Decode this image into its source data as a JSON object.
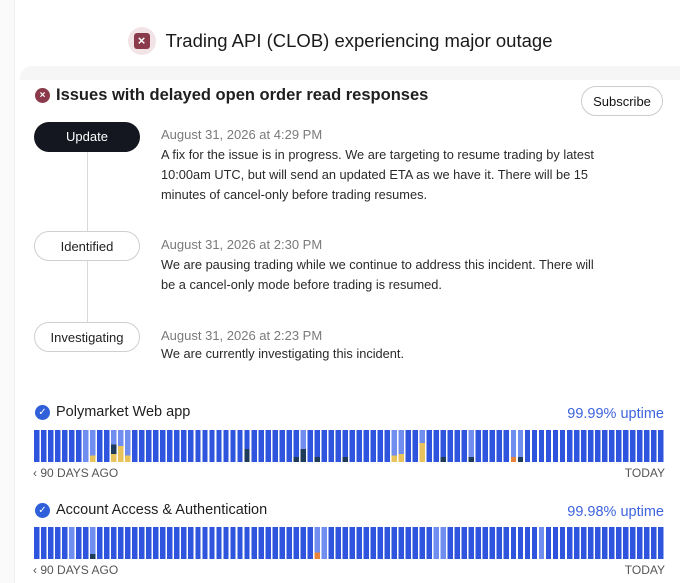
{
  "banner": {
    "icon": "x-square-icon",
    "title": "Trading API (CLOB) experiencing major outage"
  },
  "incident": {
    "icon": "x-circle-icon",
    "title": "Issues with delayed open order read responses",
    "subscribe_label": "Subscribe",
    "updates": [
      {
        "status": "Update",
        "date": "August 31, 2026 at 4:29 PM",
        "body": "A fix for the issue is in progress. We are targeting to resume trading by latest 10:00am UTC, but will send an updated ETA as we have it. There will be 15 minutes of cancel-only before trading resumes."
      },
      {
        "status": "Identified",
        "date": "August 31, 2026 at 2:30 PM",
        "body": "We are pausing trading while we continue to address this incident. There will be a cancel-only mode before trading is resumed."
      },
      {
        "status": "Investigating",
        "date": "August 31, 2026 at 2:23 PM",
        "body": "We are currently investigating this incident."
      }
    ]
  },
  "colors": {
    "accent": "#3d63dd",
    "bar_ok": "#2f55de",
    "bar_ok_light": "#6f8ef0",
    "bar_dark": "#1f3b5a",
    "bar_yellow": "#e8c25a",
    "bar_orange": "#e8843a",
    "incident": "#8a3a4a"
  },
  "components": [
    {
      "icon": "check-circle-icon",
      "name": "Polymarket Web app",
      "uptime": "99.99% uptime",
      "axis_left": "90 DAYS AGO",
      "axis_right": "TODAY",
      "days": [
        {
          "i": 7,
          "s": "light"
        },
        {
          "i": 8,
          "s": "light",
          "inc": [
            {
              "c": "yellow",
              "h": 0.2
            }
          ]
        },
        {
          "i": 11,
          "s": "light",
          "inc": [
            {
              "c": "yellow",
              "h": 0.25
            },
            {
              "c": "dark",
              "h": 0.3
            }
          ]
        },
        {
          "i": 12,
          "s": "light",
          "inc": [
            {
              "c": "yellow",
              "h": 0.5
            }
          ]
        },
        {
          "i": 13,
          "s": "light",
          "inc": [
            {
              "c": "yellow",
              "h": 0.2
            }
          ]
        },
        {
          "i": 30,
          "s": "ok",
          "inc": [
            {
              "c": "dark",
              "h": 0.4
            }
          ]
        },
        {
          "i": 37,
          "s": "ok",
          "inc": [
            {
              "c": "dark",
              "h": 0.15
            }
          ]
        },
        {
          "i": 38,
          "s": "light",
          "inc": [
            {
              "c": "dark",
              "h": 0.4
            }
          ]
        },
        {
          "i": 40,
          "s": "ok",
          "inc": [
            {
              "c": "dark",
              "h": 0.15
            }
          ]
        },
        {
          "i": 44,
          "s": "ok",
          "inc": [
            {
              "c": "dark",
              "h": 0.15
            }
          ]
        },
        {
          "i": 51,
          "s": "light",
          "inc": [
            {
              "c": "yellow",
              "h": 0.2
            }
          ]
        },
        {
          "i": 52,
          "s": "light",
          "inc": [
            {
              "c": "yellow",
              "h": 0.25
            }
          ]
        },
        {
          "i": 55,
          "s": "light",
          "inc": [
            {
              "c": "yellow",
              "h": 0.6
            }
          ]
        },
        {
          "i": 58,
          "s": "ok",
          "inc": [
            {
              "c": "dark",
              "h": 0.15
            }
          ]
        },
        {
          "i": 62,
          "s": "light",
          "inc": [
            {
              "c": "dark",
              "h": 0.15
            }
          ]
        },
        {
          "i": 68,
          "s": "light",
          "inc": [
            {
              "c": "orange",
              "h": 0.15
            }
          ]
        },
        {
          "i": 69,
          "s": "light",
          "inc": [
            {
              "c": "dark",
              "h": 0.15
            }
          ]
        }
      ]
    },
    {
      "icon": "check-circle-icon",
      "name": "Account Access & Authentication",
      "uptime": "99.98% uptime",
      "axis_left": "90 DAYS AGO",
      "axis_right": "TODAY",
      "days": [
        {
          "i": 5,
          "s": "light"
        },
        {
          "i": 8,
          "s": "light",
          "inc": [
            {
              "c": "dark",
              "h": 0.15
            }
          ]
        },
        {
          "i": 40,
          "s": "light",
          "inc": [
            {
              "c": "orange",
              "h": 0.2
            }
          ]
        },
        {
          "i": 41,
          "s": "light"
        },
        {
          "i": 57,
          "s": "light"
        },
        {
          "i": 58,
          "s": "light"
        },
        {
          "i": 72,
          "s": "light"
        }
      ]
    }
  ]
}
